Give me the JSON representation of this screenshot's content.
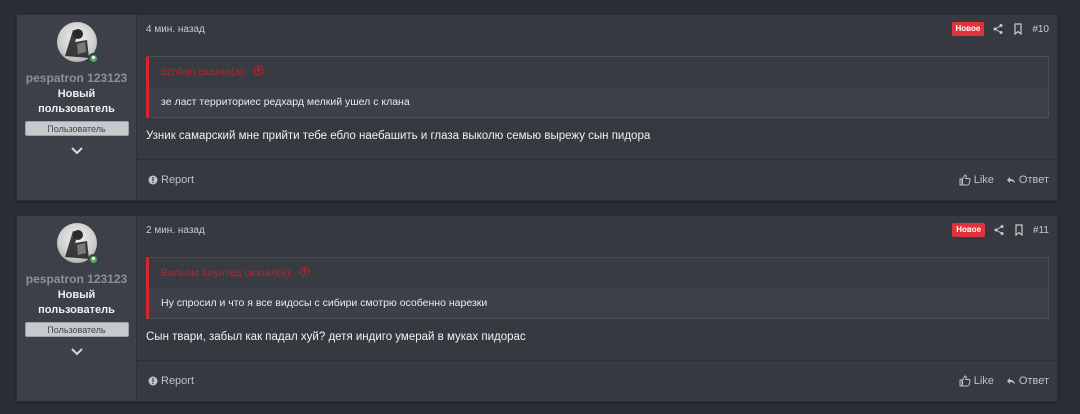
{
  "posts": [
    {
      "time": "4 мин. назад",
      "badge": "Новое",
      "number": "#10",
      "user": {
        "name": "pespatron 123123",
        "title": "Новый пользователь",
        "banner": "Пользователь"
      },
      "quote": {
        "author": "dzhfrsn сказал(а):",
        "text": "зе ласт территориес редхард мелкий ушел с клана"
      },
      "message": "Узник самарский мне прийти тебе ебло наебашить и глаза выколю семью вырежу сын пидора",
      "footer": {
        "report": "Report",
        "like": "Like",
        "reply": "Ответ"
      }
    },
    {
      "time": "2 мин. назад",
      "badge": "Новое",
      "number": "#11",
      "user": {
        "name": "pespatron 123123",
        "title": "Новый пользователь",
        "banner": "Пользователь"
      },
      "quote": {
        "author": "Вильям Хоунтед сказал(а):",
        "text": "Ну спросил и что я все видосы с сибири смотрю особенно нарезки"
      },
      "message": "Сын твари, забыл как падал хуй? детя индиго умерай в муках пидорас",
      "footer": {
        "report": "Report",
        "like": "Like",
        "reply": "Ответ"
      }
    }
  ],
  "colors": {
    "page_bg": "#2a2d33",
    "post_bg": "#363940",
    "badge_new": "#e0343d",
    "quote_accent": "#d8262e",
    "online": "#4caf50"
  },
  "icons": [
    "avatar",
    "online-status-icon",
    "chevron-down-icon",
    "share-icon",
    "bookmark-icon",
    "arrow-up-circle-icon",
    "report-icon",
    "thumbs-up-icon",
    "reply-icon"
  ]
}
